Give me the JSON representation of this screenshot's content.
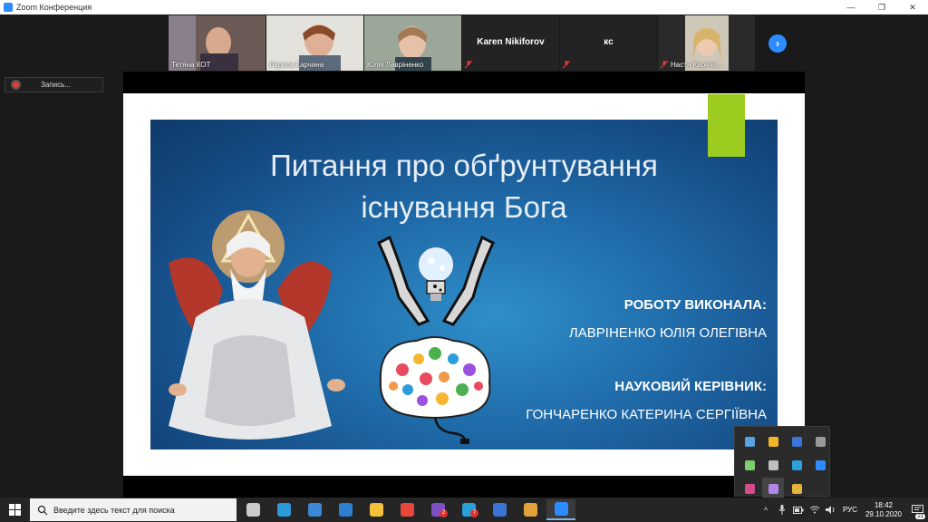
{
  "window": {
    "title": "Zoom Конференция",
    "controls": {
      "minimize": "—",
      "maximize": "❐",
      "close": "✕"
    }
  },
  "participants": [
    {
      "name": "Тетяна КОТ",
      "muted": false,
      "video": true,
      "active": false
    },
    {
      "name": "Лариса Карчина",
      "muted": false,
      "video": true,
      "active": false
    },
    {
      "name": "Юлія Лавріненко",
      "muted": false,
      "video": true,
      "active": true
    },
    {
      "name": "Karen Nikiforov",
      "muted": true,
      "video": false,
      "active": false
    },
    {
      "name": "кс",
      "muted": true,
      "video": false,
      "active": false
    },
    {
      "name": "Настя Кириче...",
      "muted": true,
      "video": true,
      "active": false
    }
  ],
  "strip": {
    "next_icon": "›"
  },
  "record": {
    "label": "Запись..."
  },
  "slide": {
    "title_line1": "Питання про обґрунтування",
    "title_line2": "існування Бога",
    "author_heading": "РОБОТУ ВИКОНАЛА",
    "author_colon": ":",
    "author_name": "ЛАВРІНЕНКО ЮЛІЯ ОЛЕГІВНА",
    "advisor_heading": "НАУКОВИЙ КЕРІВНИК:",
    "advisor_name": "ГОНЧАРЕНКО КАТЕРИНА СЕРГІЇВНА",
    "colors": {
      "accent": "#9bcc1f",
      "background": "#1f6aa8"
    }
  },
  "taskbar": {
    "search_placeholder": "Введите здесь текст для поиска",
    "apps": [
      {
        "icon": "task-view-icon",
        "color": "#cccccc",
        "badge": ""
      },
      {
        "icon": "edge-icon",
        "color": "#2b9ad8",
        "badge": ""
      },
      {
        "icon": "store-icon",
        "color": "#3d88d6",
        "badge": ""
      },
      {
        "icon": "mail-icon",
        "color": "#2f7fd1",
        "badge": ""
      },
      {
        "icon": "explorer-icon",
        "color": "#f3c13a",
        "badge": ""
      },
      {
        "icon": "chrome-icon",
        "color": "#e9473a",
        "badge": ""
      },
      {
        "icon": "viber-icon",
        "color": "#7d4fc4",
        "badge": "2"
      },
      {
        "icon": "telegram-icon",
        "color": "#2aa1da",
        "badge": "7"
      },
      {
        "icon": "wps-icon",
        "color": "#3b74d6",
        "badge": ""
      },
      {
        "icon": "settings-icon",
        "color": "#e2a23b",
        "badge": ""
      },
      {
        "icon": "zoom-icon",
        "color": "#2d8cff",
        "badge": ""
      }
    ],
    "tray": {
      "chevron": "^",
      "language": "РУС",
      "time": "18:42",
      "date": "29.10.2020",
      "notifications": "21"
    }
  },
  "tray_popup": [
    {
      "icon": "onedrive-icon",
      "color": "#5aa3e0"
    },
    {
      "icon": "security-icon",
      "color": "#f0b429"
    },
    {
      "icon": "wps-tray-icon",
      "color": "#3b74d6"
    },
    {
      "icon": "device-icon",
      "color": "#9a9a9a"
    },
    {
      "icon": "chat-icon",
      "color": "#7ccf6c"
    },
    {
      "icon": "cloud-icon",
      "color": "#bfbfbf"
    },
    {
      "icon": "telegram-tray-icon",
      "color": "#2aa1da"
    },
    {
      "icon": "zoom-tray-icon",
      "color": "#2d8cff"
    },
    {
      "icon": "shield-icon",
      "color": "#d44d8a"
    },
    {
      "icon": "feather-icon",
      "color": "#b087e6"
    },
    {
      "icon": "printer-icon",
      "color": "#e2b23b"
    }
  ]
}
